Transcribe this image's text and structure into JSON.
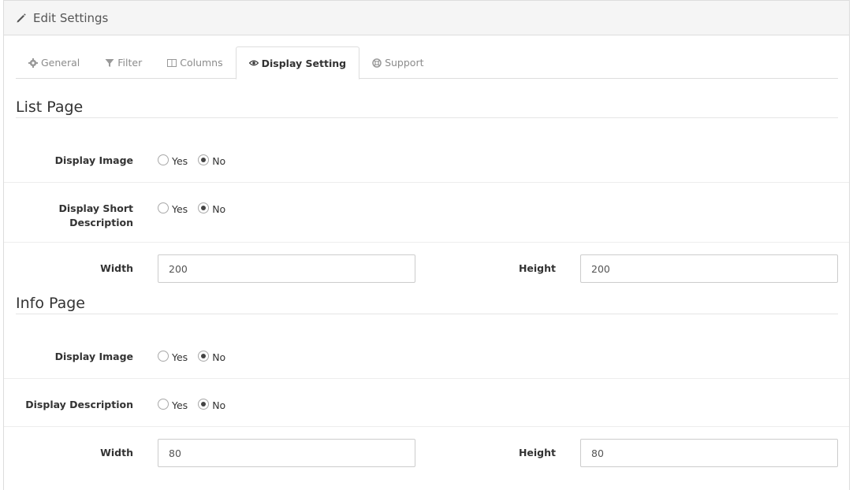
{
  "header": {
    "title": "Edit Settings",
    "icon": "pencil-icon"
  },
  "tabs": [
    {
      "label": "General",
      "icon": "gear-icon",
      "active": false
    },
    {
      "label": "Filter",
      "icon": "filter-icon",
      "active": false
    },
    {
      "label": "Columns",
      "icon": "columns-icon",
      "active": false
    },
    {
      "label": "Display Setting",
      "icon": "eye-icon",
      "active": true
    },
    {
      "label": "Support",
      "icon": "life-ring-icon",
      "active": false
    }
  ],
  "list_page": {
    "legend": "List Page",
    "display_image": {
      "label": "Display Image",
      "yes": "Yes",
      "no": "No",
      "selected": "No"
    },
    "display_short_description": {
      "label_line1": "Display Short",
      "label_line2": "Description",
      "yes": "Yes",
      "no": "No",
      "selected": "No"
    },
    "width": {
      "label": "Width",
      "value": "200"
    },
    "height": {
      "label": "Height",
      "value": "200"
    }
  },
  "info_page": {
    "legend": "Info Page",
    "display_image": {
      "label": "Display Image",
      "yes": "Yes",
      "no": "No",
      "selected": "No"
    },
    "display_description": {
      "label": "Display Description",
      "yes": "Yes",
      "no": "No",
      "selected": "No"
    },
    "width": {
      "label": "Width",
      "value": "80"
    },
    "height": {
      "label": "Height",
      "value": "80"
    }
  }
}
